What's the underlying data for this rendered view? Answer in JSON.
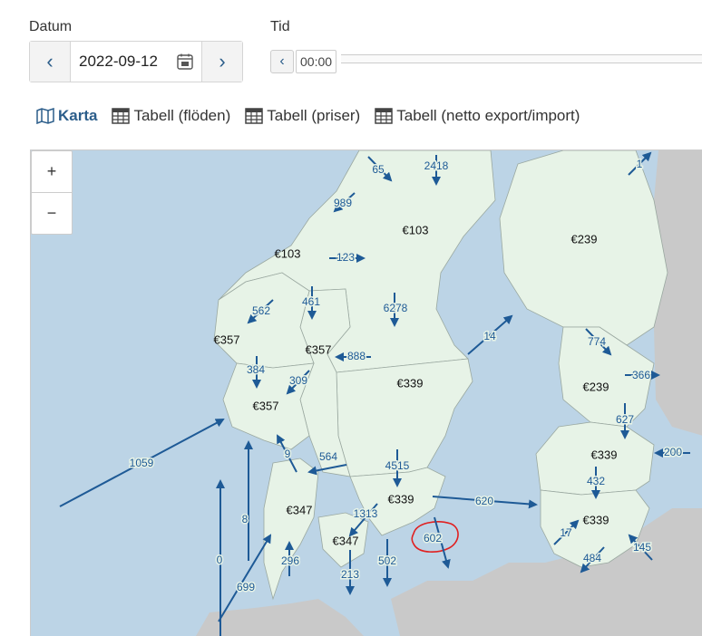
{
  "date": {
    "label": "Datum",
    "value": "2022-09-12",
    "prev": "‹",
    "next": "›",
    "calendar_icon": "calendar-icon"
  },
  "time": {
    "label": "Tid",
    "value": "00:00",
    "prev": "‹"
  },
  "tabs": [
    {
      "label": "Karta",
      "icon": "map-icon",
      "active": true
    },
    {
      "label": "Tabell (flöden)",
      "icon": "table-icon"
    },
    {
      "label": "Tabell (priser)",
      "icon": "table-icon"
    },
    {
      "label": "Tabell (netto export/import)",
      "icon": "table-icon"
    }
  ],
  "zoom": {
    "in": "+",
    "out": "−"
  },
  "prices": [
    "€103",
    "€103",
    "€239",
    "€357",
    "€357",
    "€357",
    "€339",
    "€239",
    "€339",
    "€339",
    "€339",
    "€347",
    "€347"
  ],
  "flows": [
    "65",
    "2418",
    "1",
    "989",
    "123",
    "461",
    "6278",
    "562",
    "14",
    "774",
    "888",
    "384",
    "309",
    "366",
    "627",
    "9",
    "564",
    "4515",
    "1059",
    "200",
    "432",
    "620",
    "1313",
    "17",
    "8",
    "602",
    "484",
    "145",
    "296",
    "0",
    "502",
    "213",
    "699"
  ],
  "colors": {
    "sea": "#bcd4e6",
    "zone": "#e7f3e7",
    "land": "#c9c9c9",
    "arrow": "#1e5a96",
    "highlight": "#e02020"
  }
}
